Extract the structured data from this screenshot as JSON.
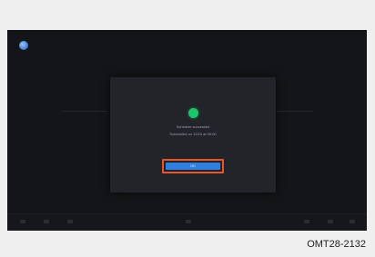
{
  "dialog": {
    "title": "Schedule successful",
    "detail": "Scheduled on 12/24 at 09:00",
    "ok_label": "OK"
  },
  "caption": "OMT28-2132",
  "colors": {
    "success": "#19c66a",
    "button": "#2f7fe0",
    "highlight": "#e8562a"
  },
  "icons": [
    "app-logo-icon",
    "check-success-icon"
  ]
}
